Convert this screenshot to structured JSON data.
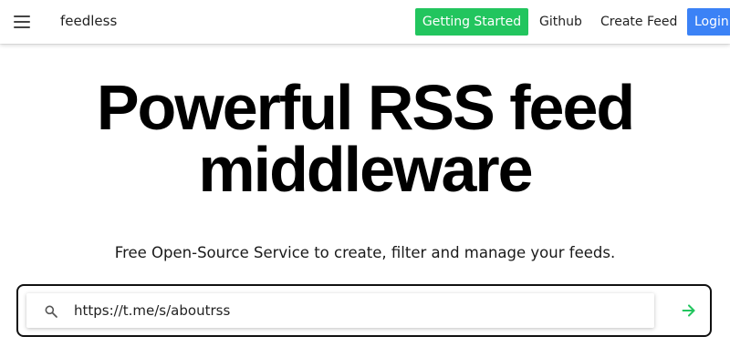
{
  "header": {
    "brand": "feedless",
    "nav": {
      "getting_started": "Getting Started",
      "github": "Github",
      "create_feed": "Create Feed",
      "login": "Login"
    }
  },
  "hero": {
    "title_line1": "Powerful RSS feed",
    "title_line2": "middleware",
    "subtitle": "Free Open-Source Service to create, filter and manage your feeds."
  },
  "search": {
    "value": "https://t.me/s/aboutrss"
  },
  "colors": {
    "getting_started_bg": "#22c55e",
    "login_bg": "#3b82f6",
    "go_arrow": "#22c55e"
  }
}
